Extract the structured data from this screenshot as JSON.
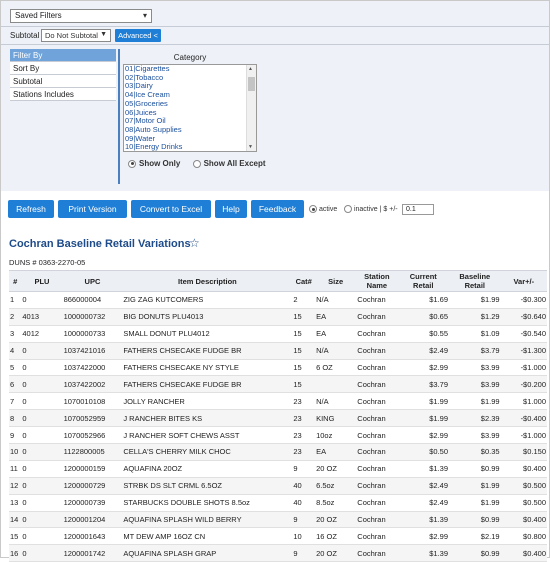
{
  "saved_filters": {
    "label": "Saved Filters"
  },
  "subtotal": {
    "label": "Subtotal",
    "value": "Do Not Subtotal",
    "advanced_label": "Advanced <"
  },
  "filter_nav": [
    "Filter By",
    "Sort By",
    "Subtotal",
    "Stations Includes"
  ],
  "category": {
    "title": "Category",
    "items": [
      "01|Cigarettes",
      "02|Tobacco",
      "03|Dairy",
      "04|Ice Cream",
      "05|Groceries",
      "06|Juices",
      "07|Motor Oil",
      "08|Auto Supplies",
      "09|Water",
      "10|Energy Drinks"
    ],
    "show_only": "Show Only",
    "show_all_except": "Show All Except"
  },
  "buttons": {
    "refresh": "Refresh",
    "print": "Print Version",
    "excel": "Convert to Excel",
    "help": "Help",
    "feedback": "Feedback"
  },
  "options": {
    "active": "active",
    "inactive": "inactive",
    "sep": "| $ +/-",
    "threshold": "0.1"
  },
  "report": {
    "title": "Cochran Baseline Retail Variations",
    "duns": "DUNS # 0363-2270-05"
  },
  "table": {
    "headers": [
      "#",
      "PLU",
      "UPC",
      "Item Description",
      "Cat#",
      "Size",
      "Station Name",
      "Current Retail",
      "Baseline Retail",
      "Var+/-"
    ],
    "rows": [
      [
        "1",
        "0",
        "866000004",
        "ZIG ZAG KUTCOMERS",
        "2",
        "N/A",
        "Cochran",
        "$1.69",
        "$1.99",
        "-$0.300"
      ],
      [
        "2",
        "4013",
        "1000000732",
        "BIG DONUTS PLU4013",
        "15",
        "EA",
        "Cochran",
        "$0.65",
        "$1.29",
        "-$0.640"
      ],
      [
        "3",
        "4012",
        "1000000733",
        "SMALL DONUT PLU4012",
        "15",
        "EA",
        "Cochran",
        "$0.55",
        "$1.09",
        "-$0.540"
      ],
      [
        "4",
        "0",
        "1037421016",
        "FATHERS CHSECAKE FUDGE BR",
        "15",
        "N/A",
        "Cochran",
        "$2.49",
        "$3.79",
        "-$1.300"
      ],
      [
        "5",
        "0",
        "1037422000",
        "FATHERS CHSECAKE NY STYLE",
        "15",
        "6 OZ",
        "Cochran",
        "$2.99",
        "$3.99",
        "-$1.000"
      ],
      [
        "6",
        "0",
        "1037422002",
        "FATHERS CHSECAKE FUDGE BR",
        "15",
        "",
        "Cochran",
        "$3.79",
        "$3.99",
        "-$0.200"
      ],
      [
        "7",
        "0",
        "1070010108",
        "JOLLY RANCHER",
        "23",
        "N/A",
        "Cochran",
        "$1.99",
        "$1.99",
        "$1.000"
      ],
      [
        "8",
        "0",
        "1070052959",
        "J RANCHER BITES KS",
        "23",
        "KING",
        "Cochran",
        "$1.99",
        "$2.39",
        "-$0.400"
      ],
      [
        "9",
        "0",
        "1070052966",
        "J RANCHER SOFT CHEWS ASST",
        "23",
        "10oz",
        "Cochran",
        "$2.99",
        "$3.99",
        "-$1.000"
      ],
      [
        "10",
        "0",
        "1122800005",
        "CELLA'S CHERRY MILK CHOC",
        "23",
        "EA",
        "Cochran",
        "$0.50",
        "$0.35",
        "$0.150"
      ],
      [
        "11",
        "0",
        "1200000159",
        "AQUAFINA 20OZ",
        "9",
        "20 OZ",
        "Cochran",
        "$1.39",
        "$0.99",
        "$0.400"
      ],
      [
        "12",
        "0",
        "1200000729",
        "STRBK DS SLT CRML 6.5OZ",
        "40",
        "6.5oz",
        "Cochran",
        "$2.49",
        "$1.99",
        "$0.500"
      ],
      [
        "13",
        "0",
        "1200000739",
        "STARBUCKS DOUBLE SHOTS 8.5oz",
        "40",
        "8.5oz",
        "Cochran",
        "$2.49",
        "$1.99",
        "$0.500"
      ],
      [
        "14",
        "0",
        "1200001204",
        "AQUAFINA SPLASH WILD BERRY",
        "9",
        "20 OZ",
        "Cochran",
        "$1.39",
        "$0.99",
        "$0.400"
      ],
      [
        "15",
        "0",
        "1200001643",
        "MT DEW AMP 16OZ CN",
        "10",
        "16 OZ",
        "Cochran",
        "$2.99",
        "$2.19",
        "$0.800"
      ],
      [
        "16",
        "0",
        "1200001742",
        "AQUAFINA SPLASH GRAP",
        "9",
        "20 OZ",
        "Cochran",
        "$1.39",
        "$0.99",
        "$0.400"
      ]
    ]
  },
  "colors": {
    "accent": "#1f7fd6",
    "title": "#1e4b8a",
    "nav_active": "#6fa3d9"
  }
}
